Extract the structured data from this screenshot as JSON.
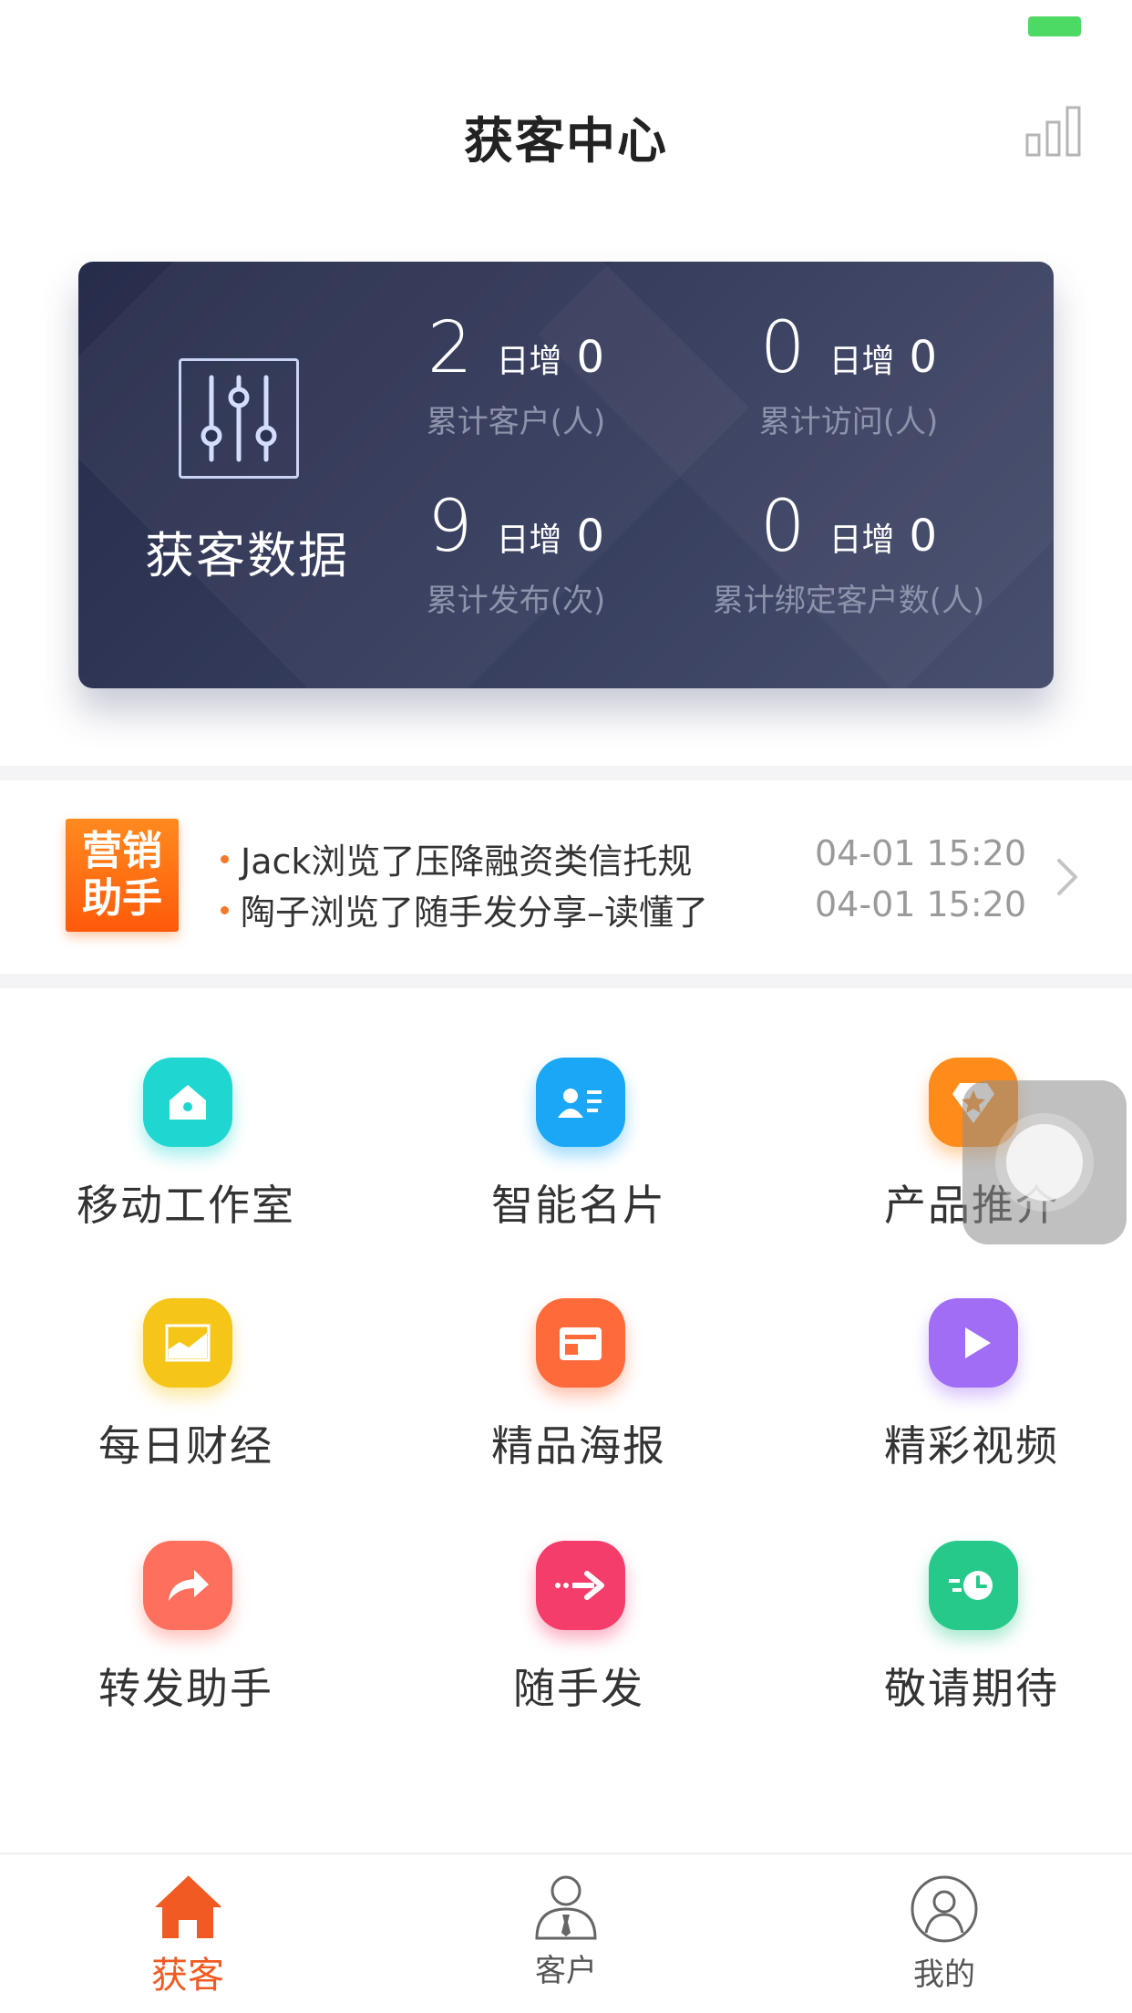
{
  "nav": {
    "title": "获客中心"
  },
  "stats_card": {
    "title": "获客数据",
    "stats": [
      {
        "value": "2",
        "inc_label": "日增",
        "inc_value": "0",
        "label": "累计客户(人)"
      },
      {
        "value": "0",
        "inc_label": "日增",
        "inc_value": "0",
        "label": "累计访问(人)"
      },
      {
        "value": "9",
        "inc_label": "日增",
        "inc_value": "0",
        "label": "累计发布(次)"
      },
      {
        "value": "0",
        "inc_label": "日增",
        "inc_value": "0",
        "label": "累计绑定客户数(人)"
      }
    ]
  },
  "marketing_helper": {
    "badge_line1": "营销",
    "badge_line2": "助手",
    "items": [
      {
        "text": "Jack浏览了压降融资类信托规",
        "time": "04-01 15:20"
      },
      {
        "text": "陶子浏览了随手发分享–读懂了",
        "time": "04-01 15:20"
      }
    ]
  },
  "features": [
    {
      "label": "移动工作室",
      "icon": "house-icon",
      "color": "#1fd6d0"
    },
    {
      "label": "智能名片",
      "icon": "id-card-icon",
      "color": "#1aa7f5"
    },
    {
      "label": "产品推介",
      "icon": "star-icon",
      "color": "#ff8c1a"
    },
    {
      "label": "每日财经",
      "icon": "chart-area-icon",
      "color": "#f5c518"
    },
    {
      "label": "精品海报",
      "icon": "image-icon",
      "color": "#ff6a3a"
    },
    {
      "label": "精彩视频",
      "icon": "play-icon",
      "color": "#a16df5"
    },
    {
      "label": "转发助手",
      "icon": "share-arrow-icon",
      "color": "#ff6f5e"
    },
    {
      "label": "随手发",
      "icon": "send-arrow-icon",
      "color": "#f53d6b"
    },
    {
      "label": "敬请期待",
      "icon": "clock-icon",
      "color": "#26c98a"
    }
  ],
  "tabbar": {
    "tabs": [
      {
        "label": "获客",
        "icon": "home-icon",
        "active": true
      },
      {
        "label": "客户",
        "icon": "customer-icon",
        "active": false
      },
      {
        "label": "我的",
        "icon": "profile-icon",
        "active": false
      }
    ],
    "active_color": "#f15a22"
  }
}
